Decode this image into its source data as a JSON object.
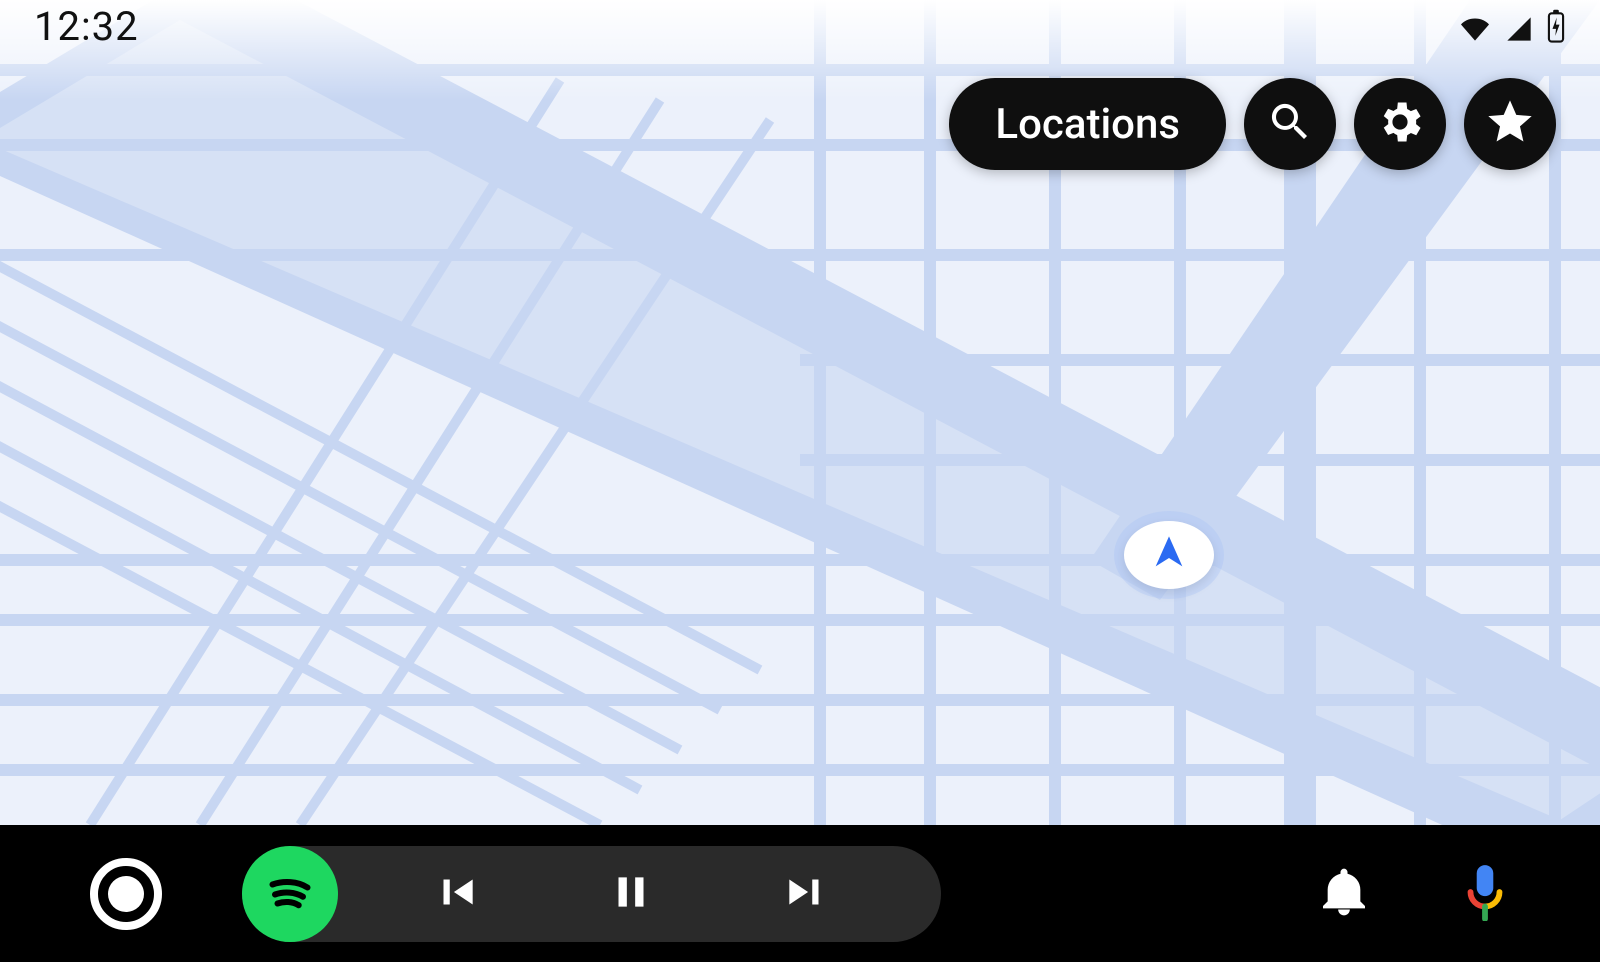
{
  "status": {
    "time": "12:32"
  },
  "controls": {
    "locations_label": "Locations"
  },
  "icons": {
    "search": "search-icon",
    "settings": "gear-icon",
    "favorites": "star-icon",
    "wifi": "wifi-icon",
    "cell": "cell-signal-icon",
    "battery": "battery-charging-icon",
    "puck": "navigation-arrow-icon",
    "home": "home-circle-icon",
    "spotify": "spotify-icon",
    "prev": "skip-previous-icon",
    "pause": "pause-icon",
    "next": "skip-next-icon",
    "bell": "notifications-icon",
    "mic": "voice-assistant-icon"
  },
  "colors": {
    "accent": "#2a6af2",
    "spotify": "#1ed760",
    "map_bg": "#ecf1fb",
    "road": "#c7d6f2",
    "road_minor": "#dae4f6"
  }
}
